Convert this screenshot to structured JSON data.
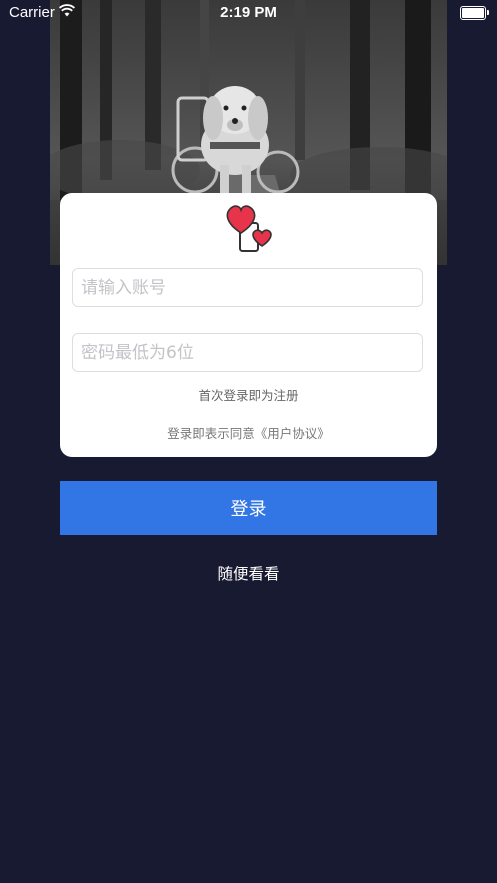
{
  "status_bar": {
    "carrier": "Carrier",
    "time": "2:19 PM",
    "battery_level": 1.0
  },
  "photo": {
    "icon": "dog-photo"
  },
  "login_card": {
    "logo_icon": "hearts-icon",
    "account_input": {
      "placeholder": "请输入账号",
      "value": ""
    },
    "password_input": {
      "placeholder": "密码最低为6位",
      "value": ""
    },
    "register_hint": "首次登录即为注册",
    "agreement_text": "登录即表示同意《用户协议》"
  },
  "login_button_label": "登录",
  "browse_label": "随便看看",
  "colors": {
    "background": "#181a31",
    "card": "#ffffff",
    "button": "#3275e4",
    "heart": "#e8344a"
  }
}
